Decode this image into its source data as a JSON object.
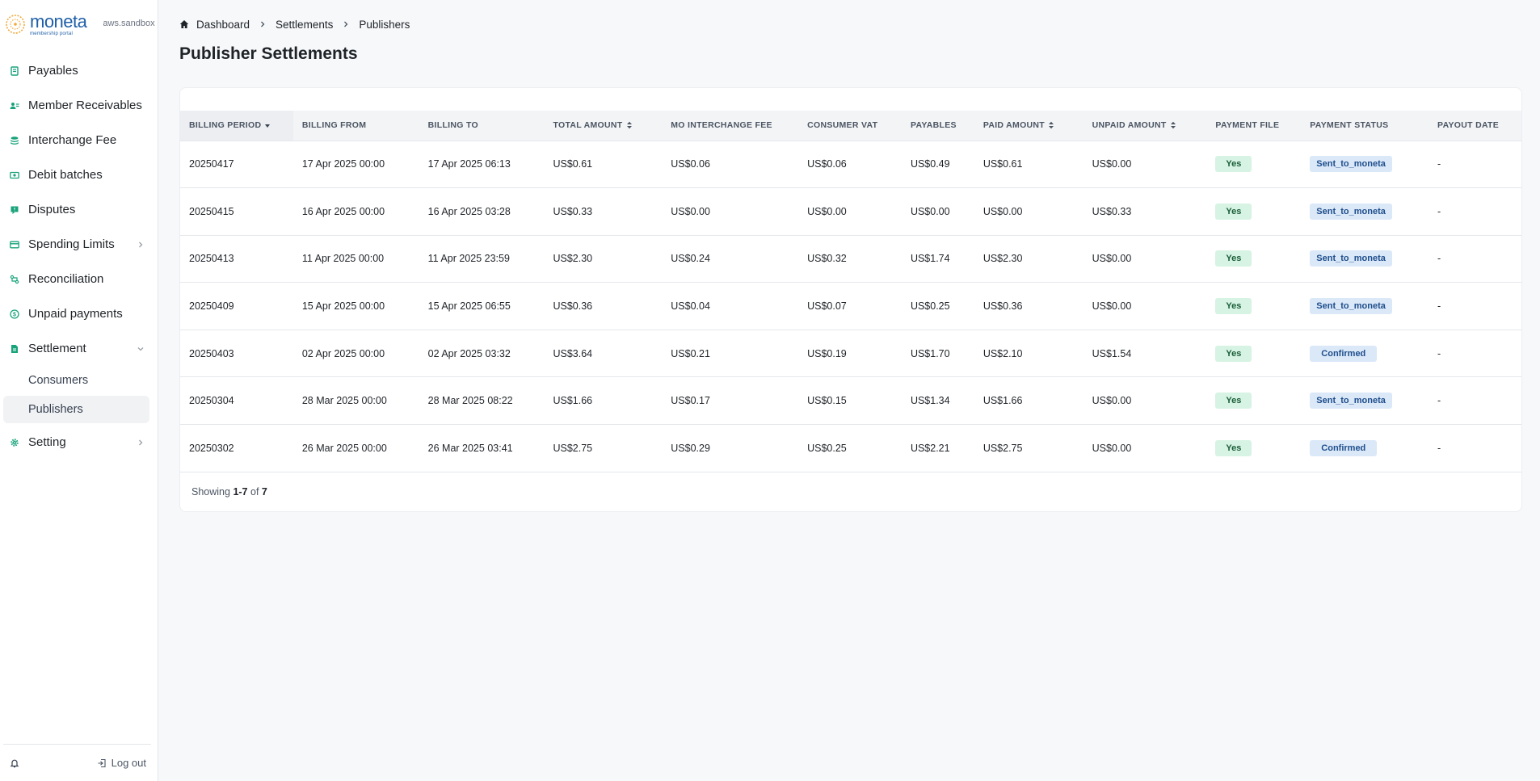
{
  "brand": {
    "name": "moneta",
    "tagline": "membership portal",
    "environment": "aws.sandbox"
  },
  "sidebar": {
    "items": [
      {
        "label": "Payables",
        "icon": "receipt-icon"
      },
      {
        "label": "Member Receivables",
        "icon": "users-icon"
      },
      {
        "label": "Interchange Fee",
        "icon": "stack-icon"
      },
      {
        "label": "Debit batches",
        "icon": "cash-icon"
      },
      {
        "label": "Disputes",
        "icon": "alert-icon"
      },
      {
        "label": "Spending Limits",
        "icon": "card-icon"
      },
      {
        "label": "Reconciliation",
        "icon": "reconcile-icon"
      },
      {
        "label": "Unpaid payments",
        "icon": "dollar-circle-icon"
      },
      {
        "label": "Settlement",
        "icon": "document-icon"
      },
      {
        "label": "Setting",
        "icon": "gear-icon"
      }
    ],
    "settlement_children": [
      "Consumers",
      "Publishers"
    ],
    "active_child": "Publishers",
    "logout_label": "Log out"
  },
  "breadcrumb": [
    "Dashboard",
    "Settlements",
    "Publishers"
  ],
  "page_title": "Publisher Settlements",
  "table": {
    "columns": [
      "BILLING PERIOD",
      "BILLING FROM",
      "BILLING TO",
      "TOTAL AMOUNT",
      "MO INTERCHANGE FEE",
      "CONSUMER VAT",
      "PAYABLES",
      "PAID AMOUNT",
      "UNPAID AMOUNT",
      "PAYMENT FILE",
      "PAYMENT STATUS",
      "PAYOUT DATE"
    ],
    "rows": [
      [
        "20250417",
        "17 Apr 2025 00:00",
        "17 Apr 2025 06:13",
        "US$0.61",
        "US$0.06",
        "US$0.06",
        "US$0.49",
        "US$0.61",
        "US$0.00",
        "Yes",
        "Sent_to_moneta",
        "-"
      ],
      [
        "20250415",
        "16 Apr 2025 00:00",
        "16 Apr 2025 03:28",
        "US$0.33",
        "US$0.00",
        "US$0.00",
        "US$0.00",
        "US$0.00",
        "US$0.33",
        "Yes",
        "Sent_to_moneta",
        "-"
      ],
      [
        "20250413",
        "11 Apr 2025 00:00",
        "11 Apr 2025 23:59",
        "US$2.30",
        "US$0.24",
        "US$0.32",
        "US$1.74",
        "US$2.30",
        "US$0.00",
        "Yes",
        "Sent_to_moneta",
        "-"
      ],
      [
        "20250409",
        "15 Apr 2025 00:00",
        "15 Apr 2025 06:55",
        "US$0.36",
        "US$0.04",
        "US$0.07",
        "US$0.25",
        "US$0.36",
        "US$0.00",
        "Yes",
        "Sent_to_moneta",
        "-"
      ],
      [
        "20250403",
        "02 Apr 2025 00:00",
        "02 Apr 2025 03:32",
        "US$3.64",
        "US$0.21",
        "US$0.19",
        "US$1.70",
        "US$2.10",
        "US$1.54",
        "Yes",
        "Confirmed",
        "-"
      ],
      [
        "20250304",
        "28 Mar 2025 00:00",
        "28 Mar 2025 08:22",
        "US$1.66",
        "US$0.17",
        "US$0.15",
        "US$1.34",
        "US$1.66",
        "US$0.00",
        "Yes",
        "Sent_to_moneta",
        "-"
      ],
      [
        "20250302",
        "26 Mar 2025 00:00",
        "26 Mar 2025 03:41",
        "US$2.75",
        "US$0.29",
        "US$0.25",
        "US$2.21",
        "US$2.75",
        "US$0.00",
        "Yes",
        "Confirmed",
        "-"
      ]
    ]
  },
  "pagination": {
    "prefix": "Showing",
    "range": "1-7",
    "of": "of",
    "total": "7"
  },
  "colors": {
    "accent": "#18a37a",
    "brand": "#1f5fa8",
    "yes_badge": "#d7f3e3",
    "status_badge": "#dbe8f8"
  }
}
